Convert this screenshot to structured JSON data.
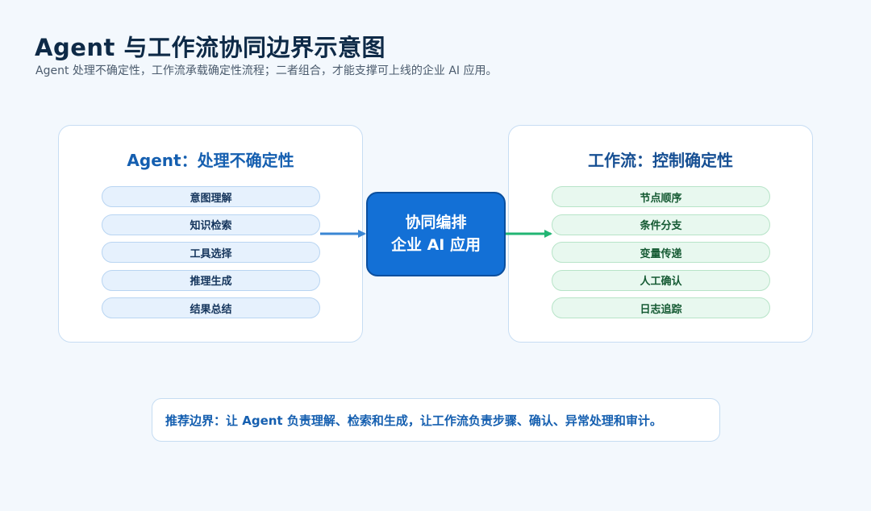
{
  "header": {
    "title": "Agent 与工作流协同边界示意图",
    "subtitle": "Agent 处理不确定性，工作流承载确定性流程；二者组合，才能支撑可上线的企业 AI 应用。"
  },
  "left_panel": {
    "title": "Agent：处理不确定性",
    "items": [
      "意图理解",
      "知识检索",
      "工具选择",
      "推理生成",
      "结果总结"
    ]
  },
  "center": {
    "line1": "协同编排",
    "line2": "企业 AI 应用"
  },
  "right_panel": {
    "title": "工作流：控制确定性",
    "items": [
      "节点顺序",
      "条件分支",
      "变量传递",
      "人工确认",
      "日志追踪"
    ]
  },
  "note": {
    "text": "推荐边界：让 Agent 负责理解、检索和生成，让工作流负责步骤、确认、异常处理和审计。"
  },
  "colors": {
    "left_arrow": "#3a86d4",
    "right_arrow": "#22b573",
    "center_fill": "#1370d6"
  }
}
